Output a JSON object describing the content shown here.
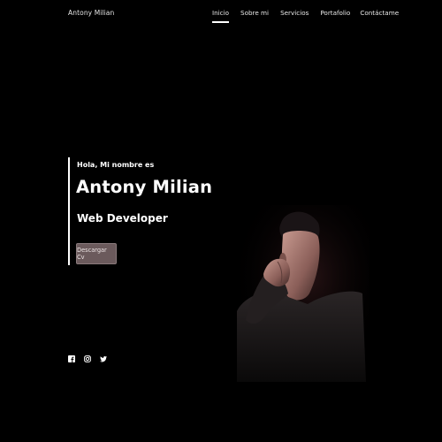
{
  "header": {
    "brand": "Antony Milian",
    "nav": [
      {
        "label": "Inicio",
        "active": true
      },
      {
        "label": "Sobre mi",
        "active": false
      },
      {
        "label": "Servicios",
        "active": false
      },
      {
        "label": "Portafolio",
        "active": false
      },
      {
        "label": "Contáctame",
        "active": false
      }
    ]
  },
  "hero": {
    "greeting": "Hola, Mi nombre es",
    "name": "Antony Milian",
    "role": "Web Developer",
    "cv_button": "Descargar Cv"
  },
  "social": {
    "icons": [
      "facebook-icon",
      "instagram-icon",
      "twitter-icon"
    ]
  },
  "colors": {
    "background": "#000000",
    "button": "#6b5a5c",
    "text": "#ffffff"
  }
}
